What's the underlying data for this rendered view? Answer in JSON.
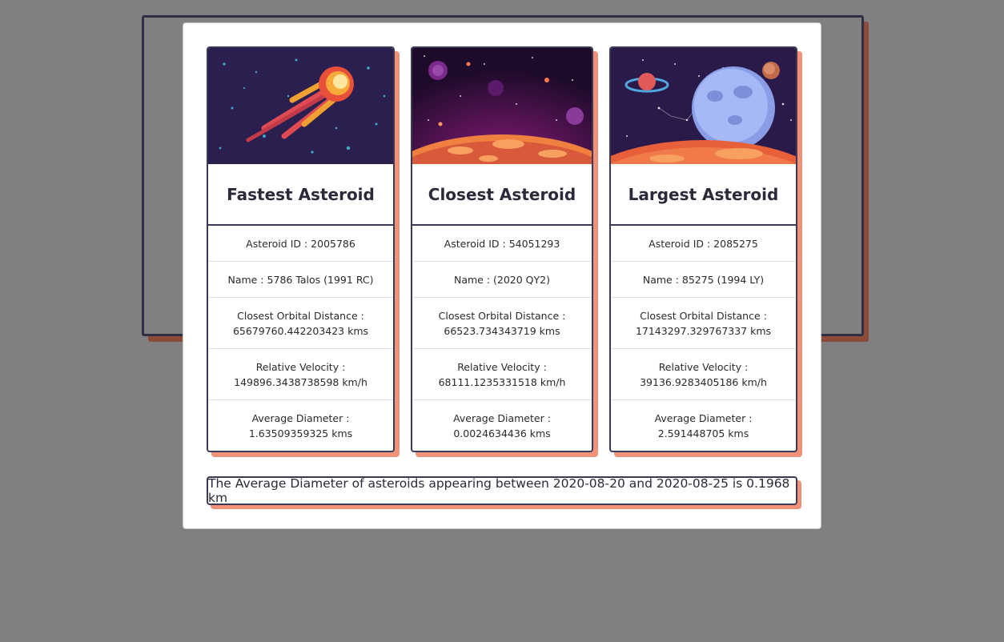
{
  "cards": [
    {
      "title": "Fastest Asteroid",
      "image": "comet-illustration",
      "asteroid_id": "Asteroid ID : 2005786",
      "name": "Name : 5786 Talos (1991 RC)",
      "distance_label": "Closest Orbital Distance :",
      "distance_value": "65679760.442203423 kms",
      "velocity_label": "Relative Velocity :",
      "velocity_value": "149896.3438738598 km/h",
      "diameter_label": "Average Diameter :",
      "diameter_value": "1.63509359325 kms"
    },
    {
      "title": "Closest Asteroid",
      "image": "planet-surface-illustration",
      "asteroid_id": "Asteroid ID : 54051293",
      "name": "Name : (2020 QY2)",
      "distance_label": "Closest Orbital Distance :",
      "distance_value": "66523.734343719 kms",
      "velocity_label": "Relative Velocity :",
      "velocity_value": "68111.1235331518 km/h",
      "diameter_label": "Average Diameter :",
      "diameter_value": "0.0024634436 kms"
    },
    {
      "title": "Largest Asteroid",
      "image": "large-planet-illustration",
      "asteroid_id": "Asteroid ID : 2085275",
      "name": "Name : 85275 (1994 LY)",
      "distance_label": "Closest Orbital Distance :",
      "distance_value": "17143297.329767337 kms",
      "velocity_label": "Relative Velocity :",
      "velocity_value": "39136.9283405186 km/h",
      "diameter_label": "Average Diameter :",
      "diameter_value": "2.591448705 kms"
    }
  ],
  "summary": "The Average Diameter of asteroids appearing between 2020-08-20 and 2020-08-25 is 0.1968 km",
  "colors": {
    "backdrop": "#808080",
    "card_border": "#3a3a55",
    "card_shadow": "#f0917a",
    "frame_shadow": "#8c4a3a"
  }
}
